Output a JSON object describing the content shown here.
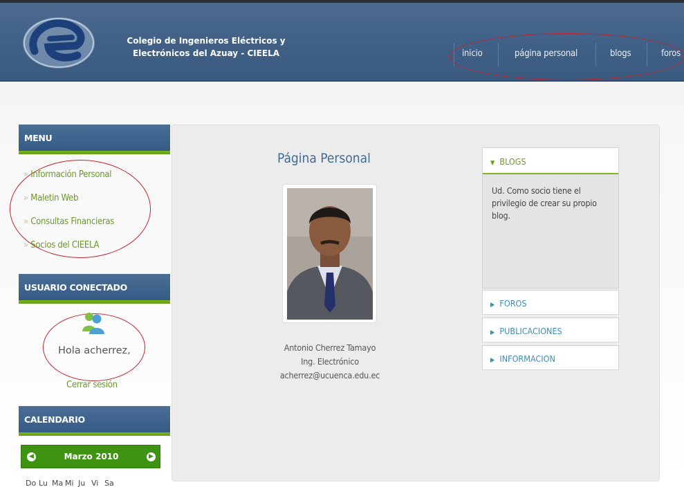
{
  "header": {
    "org_line1": "Colegio de Ingenieros Eléctricos y",
    "org_line2": "Electrónicos del Azuay - CIEELA",
    "nav": [
      "inicio",
      "página personal",
      "blogs",
      "foros"
    ]
  },
  "sidebar": {
    "menu_title": "MENU",
    "menu_items": [
      "Información Personal",
      "Maletin Web",
      "Consultas Financieras",
      "Socios del CIEELA"
    ],
    "user_title": "USUARIO CONECTADO",
    "greeting": "Hola acherrez,",
    "logout": "Cerrar sesión",
    "calendar_title": "CALENDARIO",
    "calendar": {
      "month": "Marzo 2010",
      "days": [
        "Do",
        "Lu",
        "Ma",
        "Mi",
        "Ju",
        "Vi",
        "Sa"
      ]
    }
  },
  "main": {
    "title": "Página Personal",
    "person": {
      "name": "Antonio Cherrez Tamayo",
      "profession": "Ing. Electrónico",
      "email": "acherrez@ucuenca.edu.ec"
    }
  },
  "accordion": {
    "open": {
      "label": "BLOGS",
      "text": "Ud. Como socio tiene el privilegio de crear su propio blog."
    },
    "items": [
      "FOROS",
      "PUBLICACIONES",
      "INFORMACION"
    ]
  },
  "colors": {
    "header_blue": "#3f5f85",
    "accent_green": "#6b9a24",
    "link_blue": "#3d8cb2",
    "annotation_red": "#c4232d"
  },
  "icons": [
    "logo-e-icon",
    "user-icon",
    "chevron-left-icon",
    "chevron-right-icon",
    "triangle-down-icon",
    "triangle-right-icon"
  ]
}
